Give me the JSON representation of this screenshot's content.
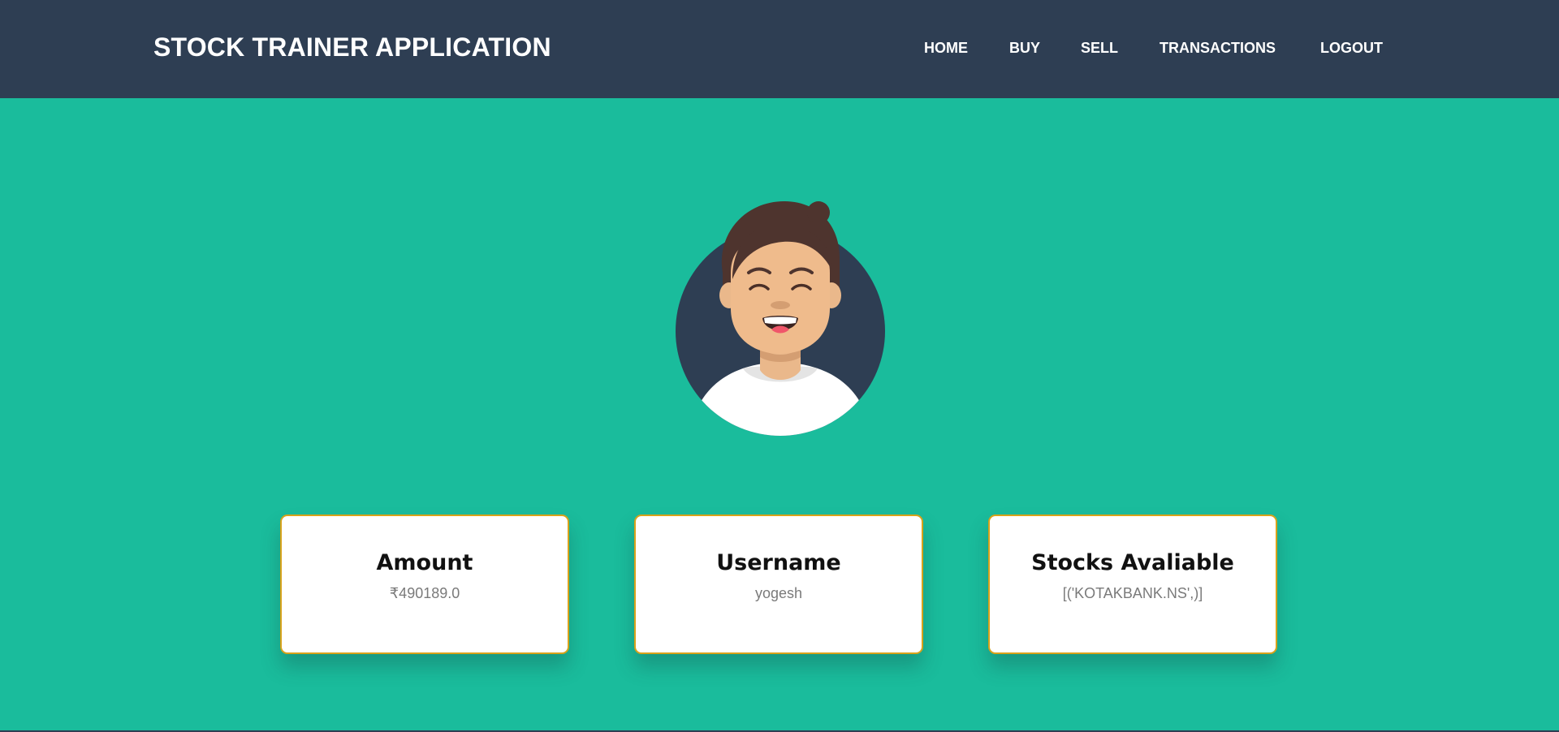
{
  "navbar": {
    "brand": "STOCK TRAINER APPLICATION",
    "links": [
      {
        "label": "HOME"
      },
      {
        "label": "BUY"
      },
      {
        "label": "SELL"
      },
      {
        "label": "TRANSACTIONS"
      },
      {
        "label": "LOGOUT"
      }
    ]
  },
  "colors": {
    "navbar_bg": "#2e3e53",
    "page_bg": "#1abc9c",
    "card_border": "#d8a21a"
  },
  "avatar": {
    "icon": "user-avatar-illustration"
  },
  "cards": [
    {
      "title": "Amount",
      "value": "₹490189.0"
    },
    {
      "title": "Username",
      "value": "yogesh"
    },
    {
      "title": "Stocks Avaliable",
      "value": "[('KOTAKBANK.NS',)]"
    }
  ]
}
